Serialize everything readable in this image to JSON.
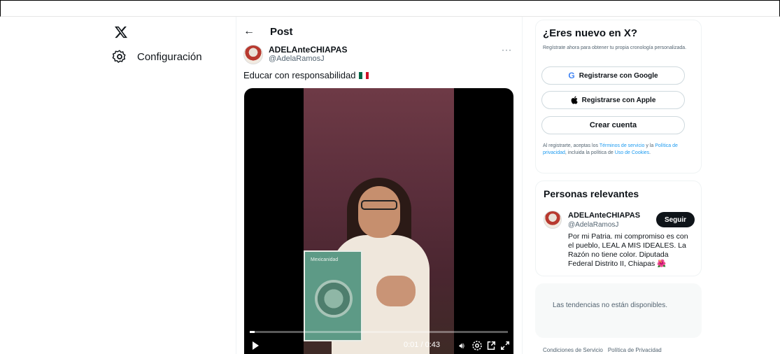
{
  "nav": {
    "settings_label": "Configuración"
  },
  "post": {
    "header_title": "Post",
    "author_name": "ADELAnteCHIAPAS",
    "author_handle": "@AdelaRamosJ",
    "text": "Educar con responsabilidad",
    "more_label": "···",
    "video": {
      "time": "0:01 / 0:43",
      "progress_fraction": 0.02,
      "book_label": "Mexicanidad"
    }
  },
  "signup": {
    "title": "¿Eres nuevo en X?",
    "subtitle": "Regístrate ahora para obtener tu propia cronología personalizada.",
    "google_label": "Registrarse con Google",
    "apple_label": "Registrarse con Apple",
    "create_label": "Crear cuenta",
    "legal_prefix": "Al registrarte, aceptas los ",
    "legal_terms": "Términos de servicio",
    "legal_and": " y la ",
    "legal_privacy": "Política de privacidad",
    "legal_including": ", incluida la política de ",
    "legal_cookies": "Uso de Cookies",
    "legal_end": "."
  },
  "relevant": {
    "title": "Personas relevantes",
    "name": "ADELAnteCHIAPAS",
    "handle": "@AdelaRamosJ",
    "follow_label": "Seguir",
    "bio": "Por mi Patria. mi compromiso es con el pueblo, LEAL A MIS IDEALES. La Razón no tiene color. Diputada Federal Distrito II, Chiapas 🌺"
  },
  "trends": {
    "message": "Las tendencias no están disponibles."
  },
  "footer": {
    "terms": "Condiciones de Servicio",
    "privacy": "Política de Privacidad"
  },
  "colors": {
    "accent": "#1d9bf0",
    "text": "#0f1419",
    "muted": "#536471"
  }
}
